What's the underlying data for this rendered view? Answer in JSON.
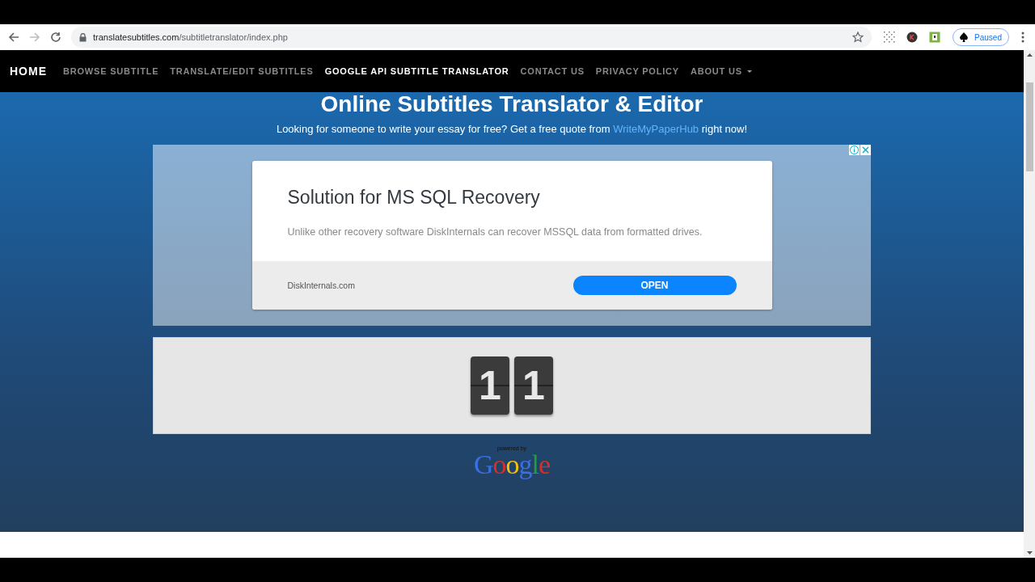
{
  "browser": {
    "url_host": "translatesubtitles.com",
    "url_path": "/subtitletranslator/index.php",
    "back_disabled": false,
    "forward_disabled": true,
    "profile_label": "Paused"
  },
  "nav": {
    "items": [
      {
        "label": "HOME",
        "selected": true
      },
      {
        "label": "BROWSE SUBTITLE",
        "selected": false
      },
      {
        "label": "TRANSLATE/EDIT SUBTITLES",
        "selected": false
      },
      {
        "label": "GOOGLE API SUBTITLE TRANSLATOR",
        "selected": true
      },
      {
        "label": "CONTACT US",
        "selected": false
      },
      {
        "label": "PRIVACY POLICY",
        "selected": false
      },
      {
        "label": "ABOUT US",
        "selected": false,
        "dropdown": true
      }
    ]
  },
  "heading": "Online Subtitles Translator & Editor",
  "promo": {
    "before": "Looking for someone to write your essay for free? Get a free quote from",
    "link": "WriteMyPaperHub",
    "after": "right now!"
  },
  "ad": {
    "title": "Solution for MS SQL Recovery",
    "body": "Unlike other recovery software DiskInternals can recover MSSQL data from formatted drives.",
    "domain": "DiskInternals.com",
    "button": "OPEN"
  },
  "counter": {
    "digits": [
      "1",
      "1"
    ]
  },
  "credit": {
    "powered_by": "powered by",
    "logo": "Google"
  }
}
